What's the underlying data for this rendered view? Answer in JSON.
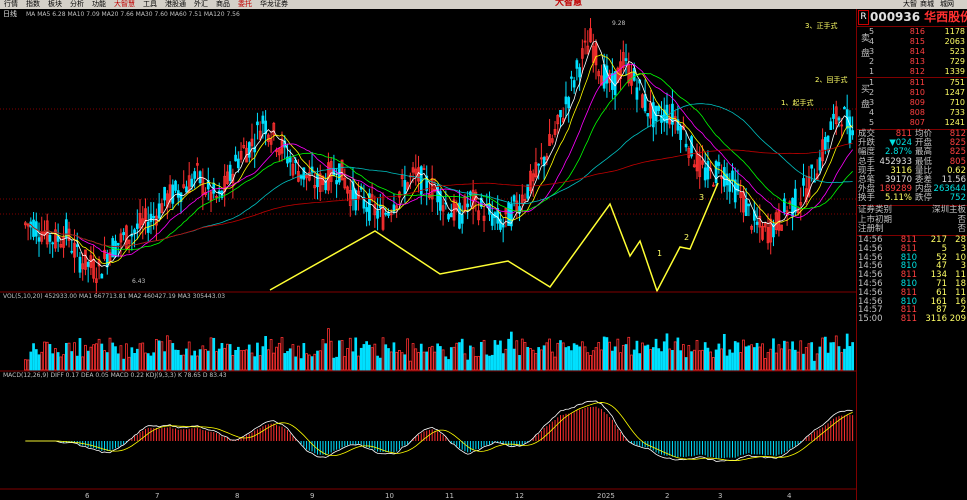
{
  "menu": [
    "行情",
    "指数",
    "板块",
    "分析",
    "功能",
    "大智慧",
    "工具",
    "港股通",
    "外汇",
    "商品",
    "委托",
    "华龙证券"
  ],
  "brand": "大智慧",
  "window_buttons": [
    "大智",
    "商城",
    "城网"
  ],
  "period_label": "日线",
  "ma_legend": "MA MA5 6.28 MA10 7.09 MA20 7.66 MA30 7.60 MA60 7.51 MA120 7.56",
  "vol_legend": "VOL(5,10,20) 452933.00 MA1 667713.81 MA2 460427.19 MA3 305443.03",
  "macd_legend": "MACD(12,26,9) DIFF 0.17 DEA 0.05 MACD 0.22 KDJ(9,3,3) K 78.65 D 83.43",
  "price_labels": {
    "high": "9.28",
    "low": "6.43"
  },
  "annotations": [
    "3、正手式",
    "2、回手式",
    "1、起手式",
    "1",
    "2",
    "3"
  ],
  "x_labels": [
    "6",
    "7",
    "8",
    "9",
    "10",
    "11",
    "12",
    "2025",
    "2",
    "3",
    "4"
  ],
  "colors": {
    "up": "#ff3030",
    "down": "#00e0ff",
    "ma5": "#ffffff",
    "ma10": "#ffff00",
    "ma20": "#ff00ff",
    "ma30": "#00ff00",
    "ma60": "#00c0c0",
    "ma120": "#c00000",
    "wave": "#ffff33",
    "grid": "#800000"
  },
  "quote": {
    "mark": "R",
    "code": "000936",
    "name": "华西股份",
    "sell_side": "卖盘",
    "buy_side": "买盘",
    "asks": [
      {
        "lv": "5",
        "price": "816",
        "vol": "1178"
      },
      {
        "lv": "4",
        "price": "815",
        "vol": "2063"
      },
      {
        "lv": "3",
        "price": "814",
        "vol": "523"
      },
      {
        "lv": "2",
        "price": "813",
        "vol": "729"
      },
      {
        "lv": "1",
        "price": "812",
        "vol": "1339"
      }
    ],
    "bids": [
      {
        "lv": "1",
        "price": "811",
        "vol": "751"
      },
      {
        "lv": "2",
        "price": "810",
        "vol": "1247"
      },
      {
        "lv": "3",
        "price": "809",
        "vol": "710"
      },
      {
        "lv": "4",
        "price": "808",
        "vol": "733"
      },
      {
        "lv": "5",
        "price": "807",
        "vol": "1241"
      }
    ],
    "stats": [
      {
        "l": "成交",
        "v": "811",
        "l2": "均价",
        "v2": "812"
      },
      {
        "l": "升跌",
        "v": "▼024",
        "l2": "开盘",
        "v2": "825"
      },
      {
        "l": "幅度",
        "v": "2.87%",
        "l2": "最高",
        "v2": "825"
      },
      {
        "l": "总手",
        "v": "452933",
        "l2": "最低",
        "v2": "805"
      },
      {
        "l": "现手",
        "v": "3116",
        "l2": "量比",
        "v2": "0.62"
      },
      {
        "l": "总笔",
        "v": "39170",
        "l2": "委差",
        "v2": "11.56"
      },
      {
        "l": "外盘",
        "v": "189289",
        "l2": "内盘",
        "v2": "263644"
      },
      {
        "l": "换手",
        "v": "5.11%",
        "l2": "跌停",
        "v2": "752"
      }
    ],
    "info": [
      {
        "l": "证券类别",
        "v": "深圳主板"
      },
      {
        "l": "上市初期",
        "v": "否"
      },
      {
        "l": "注册制",
        "v": "否"
      }
    ],
    "ticks": [
      {
        "t": "14:56",
        "p": "811",
        "q": "217",
        "c": "28"
      },
      {
        "t": "14:56",
        "p": "811",
        "q": "5",
        "c": "3"
      },
      {
        "t": "14:56",
        "p": "810",
        "q": "52",
        "c": "10"
      },
      {
        "t": "14:56",
        "p": "810",
        "q": "47",
        "c": "3"
      },
      {
        "t": "14:56",
        "p": "811",
        "q": "134",
        "c": "11"
      },
      {
        "t": "14:56",
        "p": "810",
        "q": "71",
        "c": "18"
      },
      {
        "t": "14:56",
        "p": "811",
        "q": "61",
        "c": "11"
      },
      {
        "t": "14:56",
        "p": "810",
        "q": "161",
        "c": "16"
      },
      {
        "t": "14:57",
        "p": "811",
        "q": "87",
        "c": "2"
      },
      {
        "t": "15:00",
        "p": "811",
        "q": "3116",
        "c": "209"
      }
    ]
  },
  "chart_data": {
    "type": "candlestick",
    "symbol": "000936",
    "price_high_marker": 9.28,
    "price_low_marker": 6.43,
    "x_labels": [
      "6",
      "7",
      "8",
      "9",
      "10",
      "11",
      "12",
      "2025",
      "2",
      "3",
      "4"
    ],
    "close_trend": [
      7.0,
      6.9,
      6.8,
      6.9,
      6.6,
      6.5,
      6.43,
      6.7,
      6.8,
      6.9,
      7.0,
      7.1,
      7.3,
      7.4,
      7.5,
      7.6,
      7.4,
      7.3,
      7.6,
      7.9,
      8.0,
      8.3,
      8.1,
      7.9,
      7.7,
      7.6,
      7.5,
      7.6,
      7.7,
      7.4,
      7.3,
      7.2,
      7.1,
      7.3,
      7.5,
      7.6,
      7.5,
      7.4,
      7.2,
      7.1,
      7.3,
      7.2,
      7.1,
      7.0,
      7.2,
      7.4,
      7.6,
      7.9,
      8.2,
      8.6,
      9.0,
      9.28,
      8.9,
      8.7,
      9.0,
      8.8,
      8.5,
      8.3,
      8.4,
      8.3,
      8.0,
      7.7,
      7.6,
      7.7,
      7.5,
      7.3,
      7.0,
      6.9,
      7.0,
      7.2,
      7.3,
      7.5,
      7.8,
      8.2,
      8.4,
      8.11
    ],
    "last_close": 8.11
  }
}
